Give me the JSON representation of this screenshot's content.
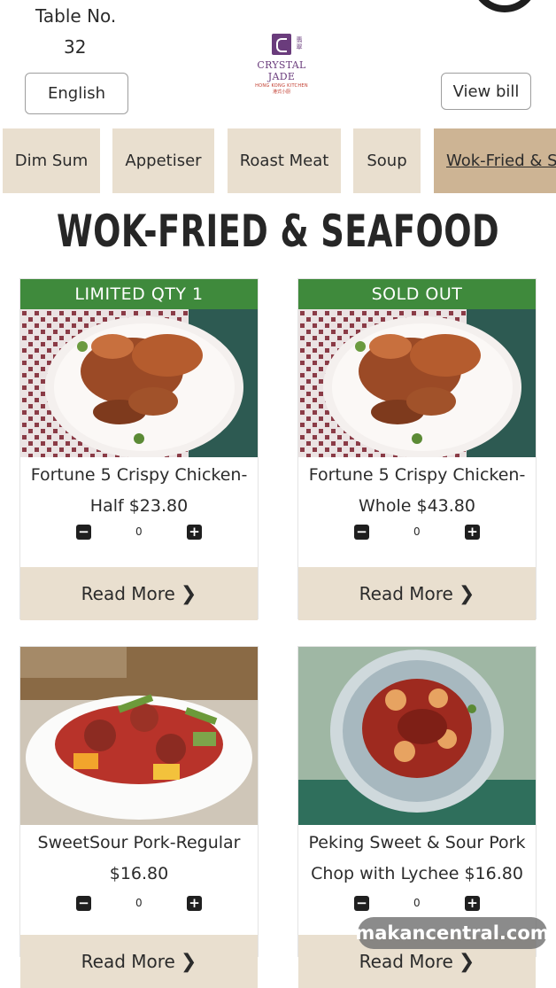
{
  "header": {
    "table_label": "Table No.",
    "table_number": "32",
    "language_button": "English",
    "view_bill_button": "View bill",
    "logo": {
      "name": "CRYSTAL JADE",
      "sub": "HONG KONG KITCHEN",
      "sub_cjk": "港式小厨",
      "mark_cjk": "翡翠"
    }
  },
  "categories": [
    "Dim Sum",
    "Appetiser",
    "Roast Meat",
    "Soup",
    "Wok-Fried & S"
  ],
  "active_category": "Wok-Fried & S",
  "section_title": "WOK-FRIED & SEAFOOD",
  "items": [
    {
      "badge": "LIMITED QTY 1",
      "name_line1": "Fortune 5 Crispy Chicken-",
      "name_line2": "Half $23.80",
      "qty": "0",
      "minus": "−",
      "plus": "+",
      "read_more": "Read More"
    },
    {
      "badge": "SOLD OUT",
      "name_line1": "Fortune 5 Crispy Chicken-",
      "name_line2": "Whole $43.80",
      "qty": "0",
      "minus": "−",
      "plus": "+",
      "read_more": "Read More"
    },
    {
      "badge": "",
      "name_line1": "SweetSour Pork-Regular",
      "name_line2": "$16.80",
      "qty": "0",
      "minus": "−",
      "plus": "+",
      "read_more": "Read More"
    },
    {
      "badge": "",
      "name_line1": "Peking Sweet & Sour Pork",
      "name_line2": "Chop with Lychee $16.80",
      "qty": "0",
      "minus": "−",
      "plus": "+",
      "read_more": "Read More"
    }
  ],
  "chevron": "❯",
  "watermark": "makancentral.com",
  "colors": {
    "tab_bg": "#e9dfcf",
    "tab_active": "#cdb494",
    "badge_green": "#3f8a3c",
    "brand_purple": "#6a3c7c"
  }
}
